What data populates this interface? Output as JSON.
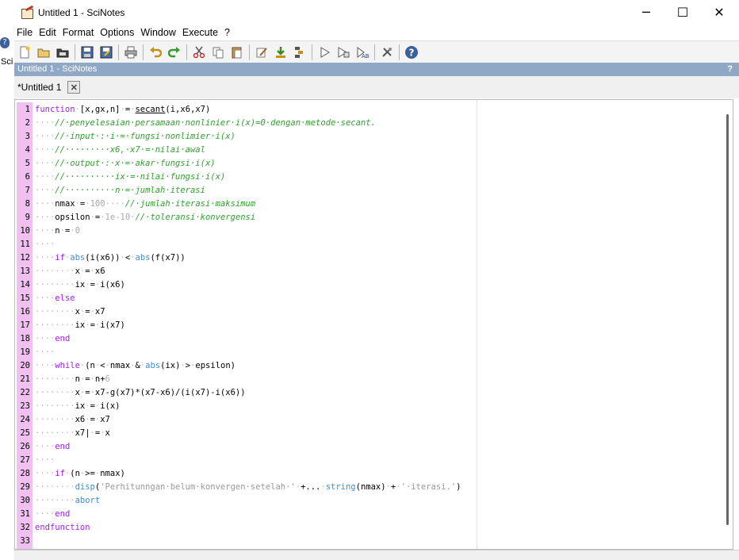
{
  "window": {
    "title": "Untitled 1 - SciNotes",
    "minimize": "─",
    "maximize": "☐",
    "close": "✕"
  },
  "left_remnant": {
    "help_glyph": "?",
    "text": "Sci"
  },
  "menu": [
    "File",
    "Edit",
    "Format",
    "Options",
    "Window",
    "Execute",
    "?"
  ],
  "dock": {
    "title": "Untitled 1 - SciNotes",
    "help": "?"
  },
  "tab": {
    "label": "*Untitled 1",
    "close_glyph": "✕"
  },
  "toolbar_icons": [
    "new-file-icon",
    "open-file-icon",
    "open-folder-icon",
    "save-icon",
    "save-as-icon",
    "print-icon",
    "undo-icon",
    "redo-icon",
    "cut-icon",
    "copy-icon",
    "paste-icon",
    "format-icon",
    "load-icon",
    "execute-file-icon",
    "run-icon",
    "run-step-icon",
    "run-selection-icon",
    "tools-icon",
    "help-icon"
  ],
  "editor": {
    "lines": [
      {
        "n": "1",
        "tokens": [
          [
            "kw",
            "function"
          ],
          [
            "ws",
            "·"
          ],
          [
            "p",
            "[x,gx,n]"
          ],
          [
            "ws",
            "·"
          ],
          [
            "p",
            "="
          ],
          [
            "ws",
            "·"
          ],
          [
            "ul",
            "secant"
          ],
          [
            "p",
            "(i,x6,x7)"
          ]
        ]
      },
      {
        "n": "2",
        "tokens": [
          [
            "ws",
            "····"
          ],
          [
            "cm",
            "//·penyelesaian·persamaan·nonlinier·i(x)=0·dengan·metode·secant."
          ]
        ]
      },
      {
        "n": "3",
        "tokens": [
          [
            "ws",
            "····"
          ],
          [
            "cm",
            "//·input·:·i·=·fungsi·nonlimier·i(x)"
          ]
        ]
      },
      {
        "n": "4",
        "tokens": [
          [
            "ws",
            "····"
          ],
          [
            "cm",
            "//·········x6,·x7·=·nilai·awal"
          ]
        ]
      },
      {
        "n": "5",
        "tokens": [
          [
            "ws",
            "····"
          ],
          [
            "cm",
            "//·output·:·x·=·akar·fungsi·i(x)"
          ]
        ]
      },
      {
        "n": "6",
        "tokens": [
          [
            "ws",
            "····"
          ],
          [
            "cm",
            "//··········ix·=·nilai·fungsi·i(x)"
          ]
        ]
      },
      {
        "n": "7",
        "tokens": [
          [
            "ws",
            "····"
          ],
          [
            "cm",
            "//··········n·=·jumlah·iterasi"
          ]
        ]
      },
      {
        "n": "8",
        "tokens": [
          [
            "ws",
            "····"
          ],
          [
            "p",
            "nmax"
          ],
          [
            "ws",
            "·"
          ],
          [
            "p",
            "="
          ],
          [
            "ws",
            "·"
          ],
          [
            "nu",
            "100"
          ],
          [
            "ws",
            "····"
          ],
          [
            "cm",
            "//·jumlah·iterasi·maksimum"
          ]
        ]
      },
      {
        "n": "9",
        "tokens": [
          [
            "ws",
            "····"
          ],
          [
            "p",
            "opsilon"
          ],
          [
            "ws",
            "·"
          ],
          [
            "p",
            "="
          ],
          [
            "ws",
            "·"
          ],
          [
            "nu",
            "1e-10"
          ],
          [
            "ws",
            "·"
          ],
          [
            "cm",
            "//·toleransi·konvergensi"
          ]
        ]
      },
      {
        "n": "10",
        "tokens": [
          [
            "ws",
            "····"
          ],
          [
            "p",
            "n"
          ],
          [
            "ws",
            "·"
          ],
          [
            "p",
            "="
          ],
          [
            "ws",
            "·"
          ],
          [
            "nu",
            "0"
          ]
        ]
      },
      {
        "n": "11",
        "tokens": [
          [
            "ws",
            "····"
          ]
        ]
      },
      {
        "n": "12",
        "tokens": [
          [
            "ws",
            "····"
          ],
          [
            "kw",
            "if"
          ],
          [
            "ws",
            "·"
          ],
          [
            "fn",
            "abs"
          ],
          [
            "p",
            "(i(x6))"
          ],
          [
            "ws",
            "·"
          ],
          [
            "p",
            "<"
          ],
          [
            "ws",
            "·"
          ],
          [
            "fn",
            "abs"
          ],
          [
            "p",
            "(f(x7))"
          ]
        ]
      },
      {
        "n": "13",
        "tokens": [
          [
            "ws",
            "········"
          ],
          [
            "p",
            "x"
          ],
          [
            "ws",
            "·"
          ],
          [
            "p",
            "="
          ],
          [
            "ws",
            "·"
          ],
          [
            "p",
            "x6"
          ]
        ]
      },
      {
        "n": "14",
        "tokens": [
          [
            "ws",
            "········"
          ],
          [
            "p",
            "ix"
          ],
          [
            "ws",
            "·"
          ],
          [
            "p",
            "="
          ],
          [
            "ws",
            "·"
          ],
          [
            "p",
            "i(x6)"
          ]
        ]
      },
      {
        "n": "15",
        "tokens": [
          [
            "ws",
            "····"
          ],
          [
            "kw",
            "else"
          ]
        ]
      },
      {
        "n": "16",
        "tokens": [
          [
            "ws",
            "········"
          ],
          [
            "p",
            "x"
          ],
          [
            "ws",
            "·"
          ],
          [
            "p",
            "="
          ],
          [
            "ws",
            "·"
          ],
          [
            "p",
            "x7"
          ]
        ]
      },
      {
        "n": "17",
        "tokens": [
          [
            "ws",
            "········"
          ],
          [
            "p",
            "ix"
          ],
          [
            "ws",
            "·"
          ],
          [
            "p",
            "="
          ],
          [
            "ws",
            "·"
          ],
          [
            "p",
            "i(x7)"
          ]
        ]
      },
      {
        "n": "18",
        "tokens": [
          [
            "ws",
            "····"
          ],
          [
            "kw",
            "end"
          ]
        ]
      },
      {
        "n": "19",
        "tokens": [
          [
            "ws",
            "····"
          ]
        ]
      },
      {
        "n": "20",
        "tokens": [
          [
            "ws",
            "····"
          ],
          [
            "kw",
            "while"
          ],
          [
            "ws",
            "·"
          ],
          [
            "p",
            "(n"
          ],
          [
            "ws",
            "·"
          ],
          [
            "p",
            "<"
          ],
          [
            "ws",
            "·"
          ],
          [
            "p",
            "nmax"
          ],
          [
            "ws",
            "·"
          ],
          [
            "p",
            "&"
          ],
          [
            "ws",
            "·"
          ],
          [
            "fn",
            "abs"
          ],
          [
            "p",
            "(ix)"
          ],
          [
            "ws",
            "·"
          ],
          [
            "p",
            ">"
          ],
          [
            "ws",
            "·"
          ],
          [
            "p",
            "epsilon)"
          ]
        ]
      },
      {
        "n": "21",
        "tokens": [
          [
            "ws",
            "········"
          ],
          [
            "p",
            "n"
          ],
          [
            "ws",
            "·"
          ],
          [
            "p",
            "="
          ],
          [
            "ws",
            "·"
          ],
          [
            "p",
            "n+"
          ],
          [
            "nu",
            "6"
          ]
        ]
      },
      {
        "n": "22",
        "tokens": [
          [
            "ws",
            "········"
          ],
          [
            "p",
            "x"
          ],
          [
            "ws",
            "·"
          ],
          [
            "p",
            "="
          ],
          [
            "ws",
            "·"
          ],
          [
            "p",
            "x7-g(x7)*(x7-x6)/(i(x7)-i(x6))"
          ]
        ]
      },
      {
        "n": "23",
        "tokens": [
          [
            "ws",
            "········"
          ],
          [
            "p",
            "ix"
          ],
          [
            "ws",
            "·"
          ],
          [
            "p",
            "="
          ],
          [
            "ws",
            "·"
          ],
          [
            "p",
            "i(x)"
          ]
        ]
      },
      {
        "n": "24",
        "tokens": [
          [
            "ws",
            "········"
          ],
          [
            "p",
            "x6"
          ],
          [
            "ws",
            "·"
          ],
          [
            "p",
            "="
          ],
          [
            "ws",
            "·"
          ],
          [
            "p",
            "x7"
          ]
        ]
      },
      {
        "n": "25",
        "tokens": [
          [
            "ws",
            "········"
          ],
          [
            "p",
            "x7"
          ],
          [
            "p",
            "|"
          ],
          [
            "ws",
            "·"
          ],
          [
            "p",
            "="
          ],
          [
            "ws",
            "·"
          ],
          [
            "p",
            "x"
          ]
        ]
      },
      {
        "n": "26",
        "tokens": [
          [
            "ws",
            "····"
          ],
          [
            "kw",
            "end"
          ]
        ]
      },
      {
        "n": "27",
        "tokens": [
          [
            "ws",
            "····"
          ]
        ]
      },
      {
        "n": "28",
        "tokens": [
          [
            "ws",
            "····"
          ],
          [
            "kw",
            "if"
          ],
          [
            "ws",
            "·"
          ],
          [
            "p",
            "(n"
          ],
          [
            "ws",
            "·"
          ],
          [
            "p",
            ">="
          ],
          [
            "ws",
            "·"
          ],
          [
            "p",
            "nmax)"
          ]
        ]
      },
      {
        "n": "29",
        "tokens": [
          [
            "ws",
            "········"
          ],
          [
            "fn",
            "disp"
          ],
          [
            "p",
            "("
          ],
          [
            "st",
            "'Perhitunngan·belum·konvergen·setelah·'"
          ],
          [
            "ws",
            "·"
          ],
          [
            "p",
            "+..."
          ],
          [
            "ws",
            "·"
          ],
          [
            "fn",
            "string"
          ],
          [
            "p",
            "(nmax)"
          ],
          [
            "ws",
            "·"
          ],
          [
            "p",
            "+"
          ],
          [
            "ws",
            "·"
          ],
          [
            "st",
            "'·iterasi.'"
          ],
          [
            "p",
            ")"
          ]
        ]
      },
      {
        "n": "30",
        "tokens": [
          [
            "ws",
            "········"
          ],
          [
            "fn",
            "abort"
          ]
        ]
      },
      {
        "n": "31",
        "tokens": [
          [
            "ws",
            "····"
          ],
          [
            "kw",
            "end"
          ]
        ]
      },
      {
        "n": "32",
        "tokens": [
          [
            "kw",
            "endfunction"
          ]
        ]
      },
      {
        "n": "33",
        "tokens": []
      }
    ]
  }
}
